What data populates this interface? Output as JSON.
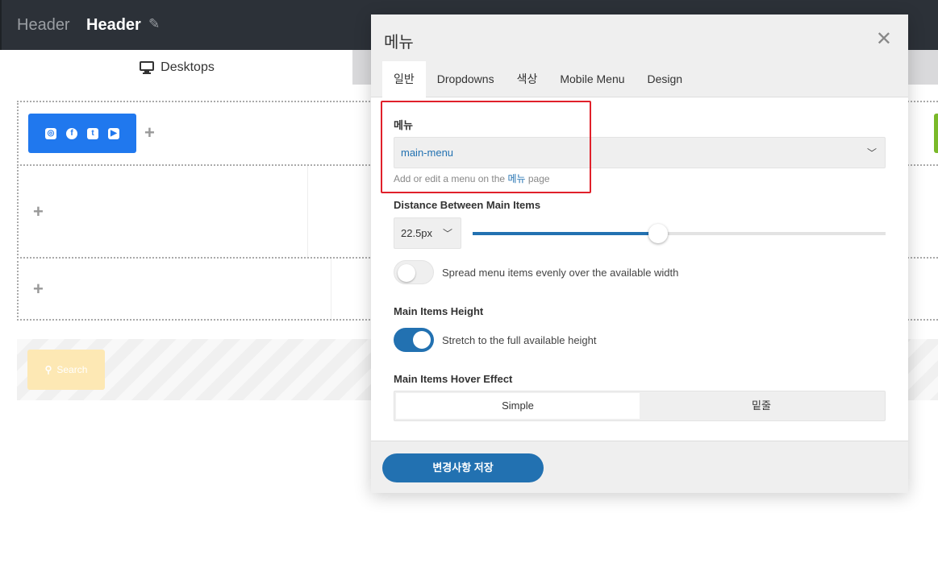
{
  "topbar": {
    "crumb": "Header",
    "title": "Header",
    "edit_icon": "pencil-icon"
  },
  "device_tab": {
    "label": "Desktops",
    "icon": "monitor-icon"
  },
  "builder": {
    "social_icons": [
      "instagram-icon",
      "facebook-icon",
      "twitter-icon",
      "youtube-icon"
    ],
    "search_label": "Search",
    "add_icon": "plus-icon"
  },
  "modal": {
    "title": "메뉴",
    "close_icon": "close-icon",
    "tabs": [
      "일반",
      "Dropdowns",
      "색상",
      "Mobile Menu",
      "Design"
    ],
    "active_tab": "일반",
    "menu_label": "메뉴",
    "menu_value": "main-menu",
    "help_prefix": "Add or edit a menu on the",
    "help_link": "메뉴",
    "help_suffix": "page",
    "distance_label": "Distance Between Main Items",
    "distance_unit": "22.5px",
    "distance_slider_percent": 45,
    "spread_label": "Spread menu items evenly over the available width",
    "spread_on": false,
    "height_label": "Main Items Height",
    "stretch_label": "Stretch to the full available height",
    "stretch_on": true,
    "hover_label": "Main Items Hover Effect",
    "hover_options": [
      "Simple",
      "밑줄"
    ],
    "hover_selected": "Simple",
    "save_label": "변경사항 저장"
  },
  "colors": {
    "accent": "#2271b1",
    "highlight": "#e0202a",
    "social": "#2078ee"
  }
}
